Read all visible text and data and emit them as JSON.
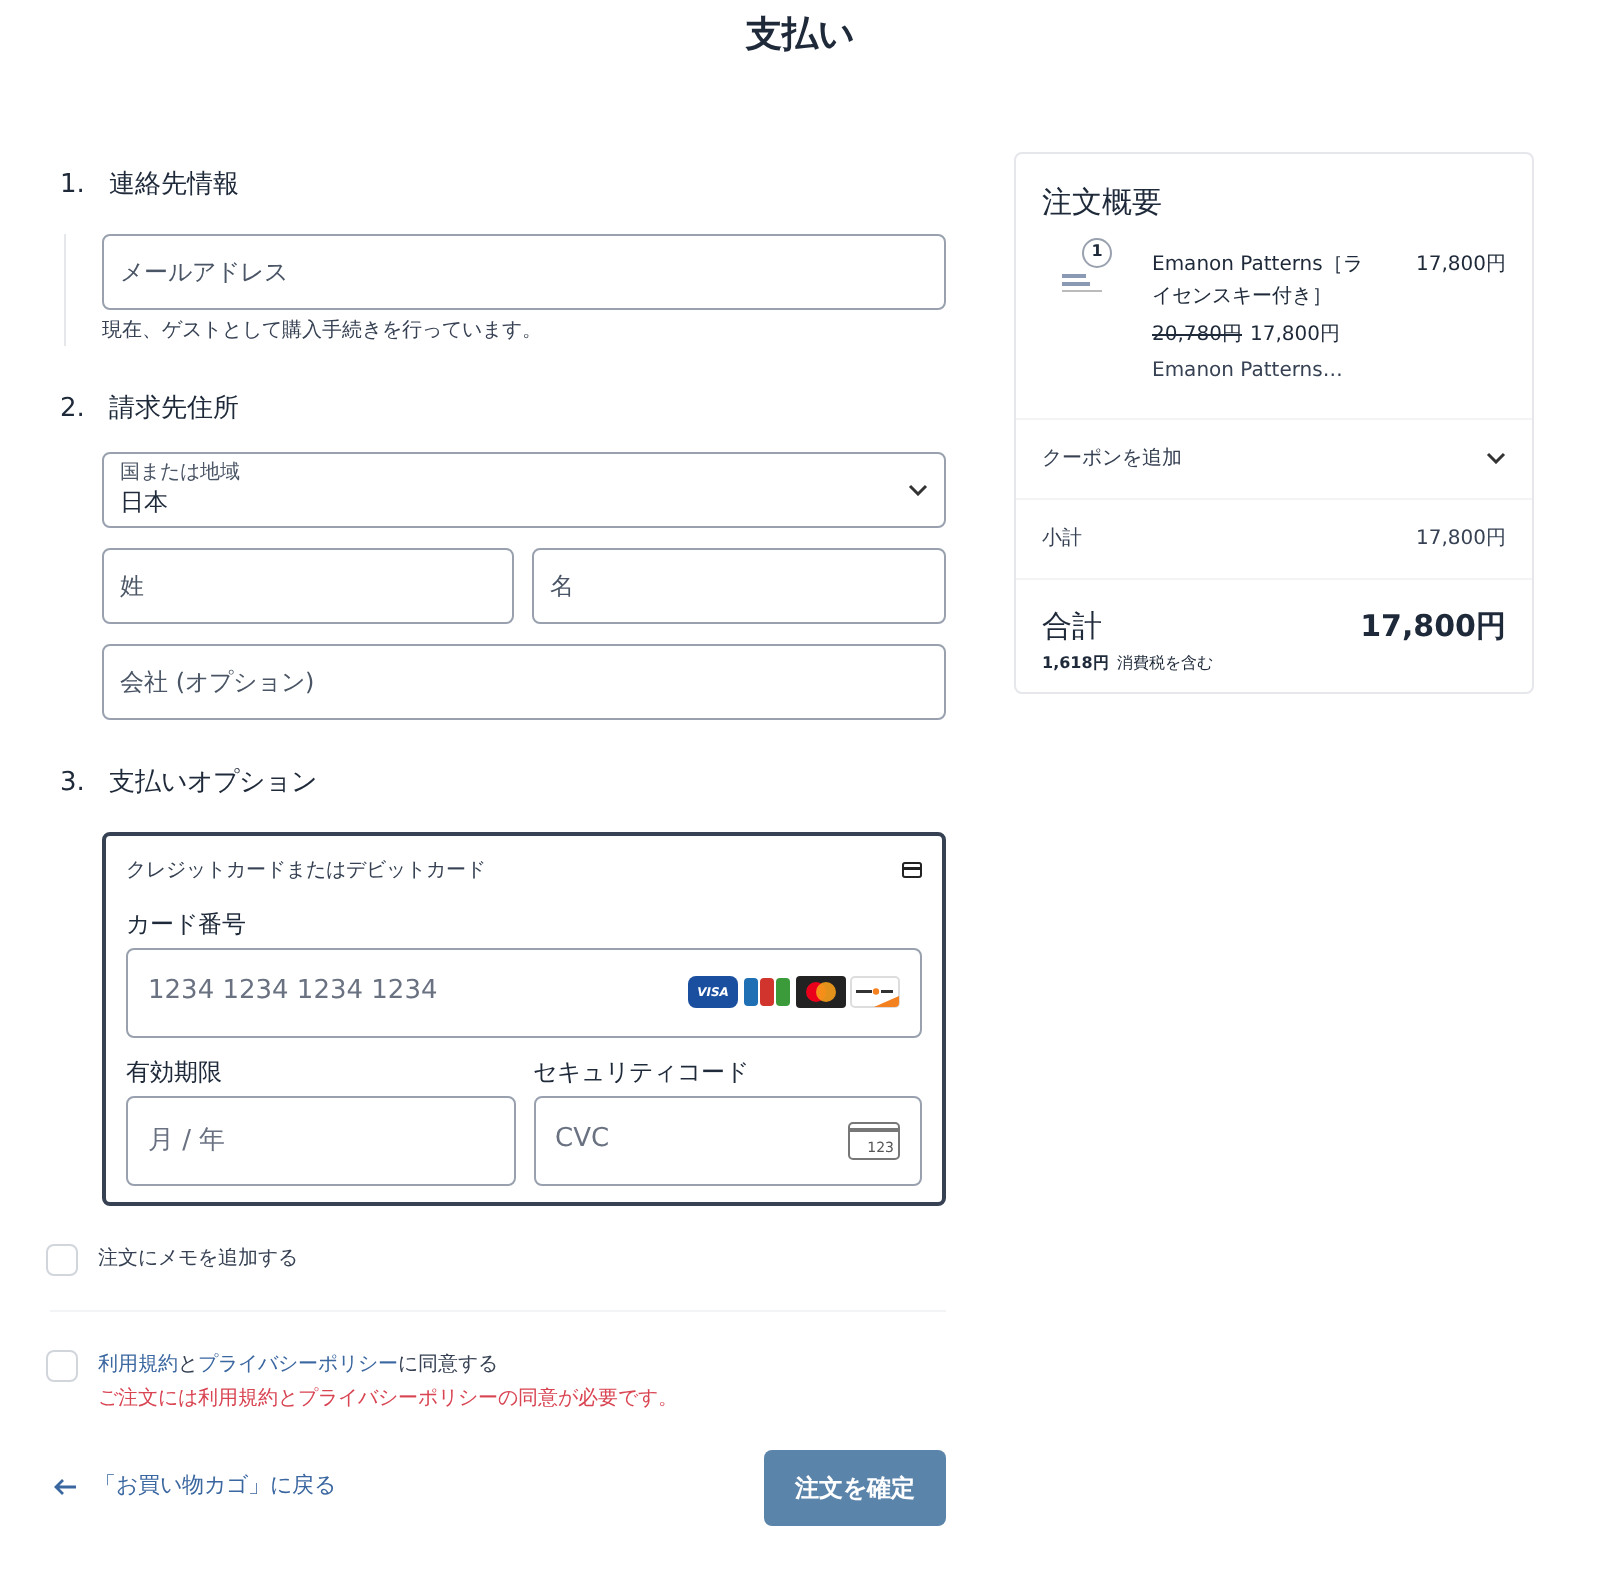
{
  "title": "支払い",
  "contact": {
    "number": "1.",
    "heading": "連絡先情報",
    "email_placeholder": "メールアドレス",
    "note": "現在、ゲストとして購入手続きを行っています。"
  },
  "billing": {
    "number": "2.",
    "heading": "請求先住所",
    "country_label": "国または地域",
    "country_value": "日本",
    "last_name_placeholder": "姓",
    "first_name_placeholder": "名",
    "company_placeholder": "会社 (オプション)"
  },
  "payment": {
    "number": "3.",
    "heading": "支払いオプション",
    "method": "クレジットカードまたはデビットカード",
    "card_number_label": "カード番号",
    "card_number_placeholder": "1234 1234 1234 1234",
    "card_brands": [
      {
        "kind": "visa",
        "label": "VISA"
      },
      {
        "kind": "jcb"
      },
      {
        "kind": "mastercard"
      },
      {
        "kind": "discover"
      }
    ],
    "expiry_label": "有効期限",
    "expiry_placeholder": "月 / 年",
    "cvc_label": "セキュリティコード",
    "cvc_placeholder": "CVC",
    "cvc_icon_text": "123"
  },
  "order_note": {
    "label": "注文にメモを追加する",
    "checked": false
  },
  "terms": {
    "checked": false,
    "parts": [
      {
        "kind": "link",
        "text": "利用規約"
      },
      {
        "kind": "text",
        "text": "と"
      },
      {
        "kind": "link",
        "text": "プライバシーポリシー"
      },
      {
        "kind": "text",
        "text": "に同意する"
      }
    ],
    "error": "ご注文には利用規約とプライバシーポリシーの同意が必要です。"
  },
  "back_link": "「お買い物カゴ」に戻る",
  "submit": "注文を確定",
  "summary": {
    "title": "注文概要",
    "items": [
      {
        "quantity": "1",
        "name": "Emanon Patterns［ライセンスキー付き］",
        "original_price": "20,780円",
        "price": "17,800円",
        "line_total": "17,800円",
        "description": "Emanon Patterns…"
      }
    ],
    "coupon": "クーポンを追加",
    "subtotal_label": "小計",
    "subtotal_value": "17,800円",
    "total_label": "合計",
    "total_value": "17,800円",
    "tax_amount": "1,618円",
    "tax_label": "消費税を含む"
  }
}
